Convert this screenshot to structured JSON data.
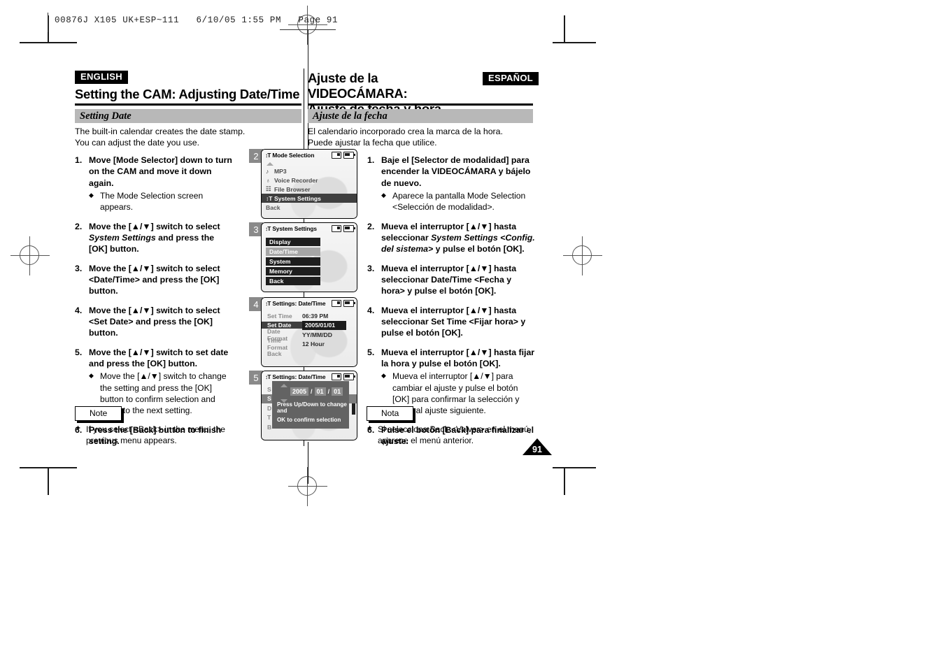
{
  "print_header": "00876J X105 UK+ESP~111   6/10/05 1:55 PM   Page 91",
  "english": {
    "lang_badge": "ENGLISH",
    "chapter_title": "Setting the CAM: Adjusting Date/Time",
    "section_title": "Setting Date",
    "intro_line1": "The built-in calendar creates the date stamp.",
    "intro_line2": "You can adjust the date you use.",
    "steps": [
      {
        "num": "1.",
        "text": "Move [Mode Selector] down to turn on the CAM and move it down again.",
        "subs": [
          "The Mode Selection screen appears."
        ]
      },
      {
        "num": "2.",
        "text_pre": "Move the [▲/▼] switch to select ",
        "text_em": "System Settings",
        "text_post": " and press the [OK] button.",
        "subs": []
      },
      {
        "num": "3.",
        "text": "Move the [▲/▼] switch to select <Date/Time> and press the [OK] button.",
        "subs": []
      },
      {
        "num": "4.",
        "text": "Move the [▲/▼] switch to select <Set Date> and press the [OK] button.",
        "subs": []
      },
      {
        "num": "5.",
        "text": "Move the [▲/▼] switch to set date and press the [OK] button.",
        "subs": [
          "Move the [▲/▼] switch to change the setting and press the [OK] button to confirm selection and move to the next setting."
        ]
      },
      {
        "num": "6.",
        "text": "Press the [Back] button to finish setting.",
        "subs": []
      }
    ],
    "note_label": "Note",
    "note_bullet": "✦",
    "note_text": "If you select <Back> in the menu, the previous menu appears."
  },
  "spanish": {
    "lang_badge": "ESPAÑOL",
    "chapter_title_line1": "Ajuste de la VIDEOCÁMARA:",
    "chapter_title_line2": "Ajuste de fecha y hora",
    "section_title": "Ajuste de la fecha",
    "intro_line1": "El calendario incorporado crea la marca de la hora.",
    "intro_line2": "Puede ajustar la fecha que utilice.",
    "steps": [
      {
        "num": "1.",
        "text": "Baje el [Selector de modalidad] para encender la VIDEOCÁMARA y bájelo de nuevo.",
        "subs": [
          "Aparece la pantalla Mode Selection <Selección de modalidad>."
        ]
      },
      {
        "num": "2.",
        "text_pre": "Mueva el interruptor [▲/▼] hasta seleccionar ",
        "text_em": "System Settings <Config. del sistema>",
        "text_post": " y pulse el botón [OK].",
        "subs": []
      },
      {
        "num": "3.",
        "text": "Mueva el interruptor [▲/▼] hasta seleccionar Date/Time <Fecha y hora> y pulse el botón [OK].",
        "subs": []
      },
      {
        "num": "4.",
        "text": "Mueva el interruptor [▲/▼] hasta seleccionar Set Time <Fijar hora> y pulse el botón [OK].",
        "subs": []
      },
      {
        "num": "5.",
        "text": "Mueva el interruptor [▲/▼] hasta fijar la hora y pulse el botón [OK].",
        "subs": [
          "Mueva el interruptor [▲/▼] para cambiar el ajuste y pulse el botón [OK] para confirmar la selección y pasar al ajuste siguiente."
        ]
      },
      {
        "num": "6.",
        "text": "Pulse el botón [Back] para finalizar el ajuste.",
        "subs": []
      }
    ],
    "note_label": "Nota",
    "note_bullet": "✦",
    "note_text": "Si selecciona Back <Volver> en el menú, aparece el menú anterior."
  },
  "page_number": "91",
  "screens": [
    {
      "chip": "2",
      "title": "Mode Selection",
      "title_icon": "↕T",
      "rows": [
        {
          "icon": "♪",
          "label": "MP3",
          "state": "normal"
        },
        {
          "icon": "♁",
          "label": "Voice Recorder",
          "state": "normal"
        },
        {
          "icon": "☷",
          "label": "File Browser",
          "state": "normal"
        },
        {
          "icon": "↕T",
          "label": "System Settings",
          "state": "selected"
        },
        {
          "icon": "",
          "label": "Back",
          "state": "plain"
        }
      ]
    },
    {
      "chip": "3",
      "title": "System Settings",
      "title_icon": "↕T",
      "rows": [
        {
          "label": "Display",
          "state": "normal"
        },
        {
          "label": "Date/Time",
          "state": "selected"
        },
        {
          "label": "System",
          "state": "normal"
        },
        {
          "label": "Memory",
          "state": "normal"
        },
        {
          "label": "Back",
          "state": "normal"
        }
      ]
    },
    {
      "chip": "4",
      "title": "Settings: Date/Time",
      "title_icon": "↕T",
      "rows": [
        {
          "key": "Set Time",
          "value": "06:39 PM",
          "state": "normal"
        },
        {
          "key": "Set Date",
          "value": "2005/01/01",
          "state": "selected"
        },
        {
          "key": "Date Format",
          "value": "YY/MM/DD",
          "state": "normal"
        },
        {
          "key": "Time Format",
          "value": "12 Hour",
          "state": "normal"
        },
        {
          "key": "Back",
          "value": "",
          "state": "normal"
        }
      ]
    },
    {
      "chip": "5",
      "title": "Settings: Date/Time",
      "title_icon": "↕T",
      "ghost_rows": [
        "S",
        "S",
        "D",
        "T",
        "B"
      ],
      "overlay": {
        "year": "2005",
        "month": "01",
        "day": "01",
        "sep": "/",
        "hint_line1": "Press Up/Down to change and",
        "hint_line2": "OK to confirm selection"
      }
    }
  ]
}
